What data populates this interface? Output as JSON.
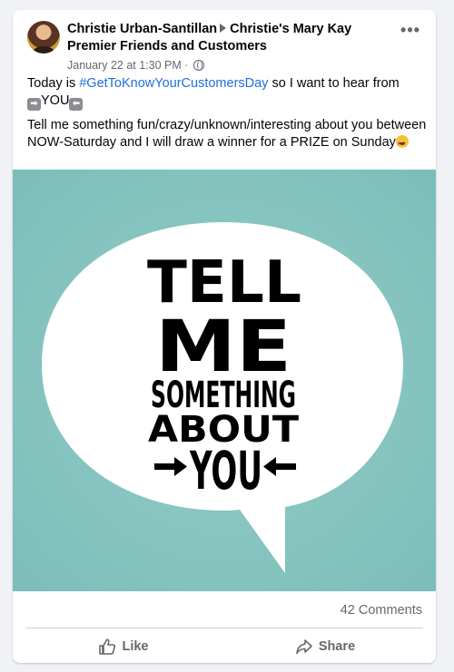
{
  "post": {
    "author": "Christie Urban-Santillan",
    "group": "Christie's Mary Kay Premier Friends and Customers",
    "timestamp": "January 22 at 1:30 PM",
    "privacy_separator": "·",
    "more_label": "•••",
    "text_line1_before": "Today is ",
    "hashtag": "#GetToKnowYourCustomersDay",
    "text_line1_after": " so I want to hear from ",
    "arrow_right": "➡",
    "you_word": "YOU",
    "arrow_left": "⬅",
    "text_paragraph2": "Tell me something fun/crazy/unknown/interesting about you between NOW-Saturday and I will draw a winner for a PRIZE on Sunday",
    "image": {
      "line1": "TELL",
      "line2": "ME",
      "line3": "SOMETHING",
      "line4": "ABOUT",
      "line5": "YOU",
      "background_color": "#89c7c3",
      "bubble_color": "#ffffff",
      "text_color": "#000000"
    }
  },
  "footer": {
    "comments": "42 Comments",
    "like_label": "Like",
    "share_label": "Share"
  },
  "icons": {
    "globe": "globe-icon",
    "like": "thumbs-up-icon",
    "share": "share-arrow-icon",
    "more": "more-horizontal-icon"
  }
}
